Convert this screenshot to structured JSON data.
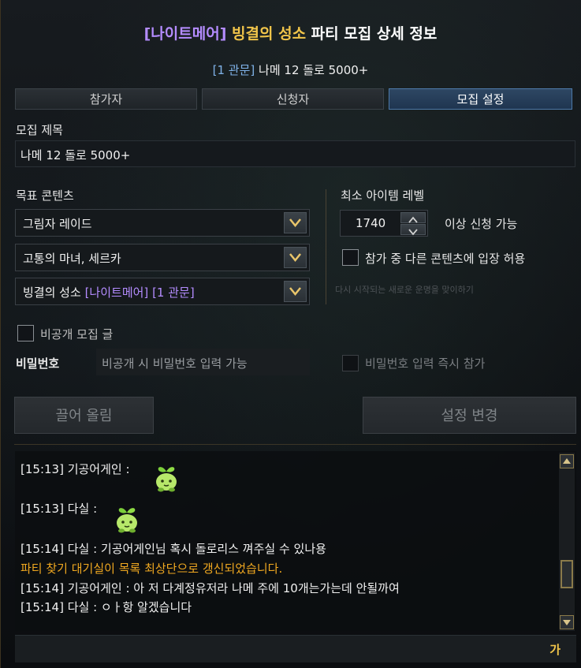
{
  "title": {
    "difficulty": "[나이트메어]",
    "raid": "빙결의 성소",
    "rest": "파티 모집 상세 정보"
  },
  "subtitle": {
    "gate": "[1 관문]",
    "text": "나메 12 돌로 5000+"
  },
  "tabs": [
    {
      "label": "참가자",
      "active": false
    },
    {
      "label": "신청자",
      "active": false
    },
    {
      "label": "모집 설정",
      "active": true
    }
  ],
  "recruit_title": {
    "label": "모집 제목",
    "value": "나메 12 돌로 5000+"
  },
  "target_content": {
    "label": "목표 콘텐츠",
    "selects": [
      {
        "value": "그림자 레이드"
      },
      {
        "value": "고통의 마녀, 세르카"
      },
      {
        "value_main": "빙결의 성소",
        "value_diff": "[나이트메어]",
        "value_gate": "[1 관문]"
      }
    ]
  },
  "min_item_level": {
    "label": "최소 아이템 레벨",
    "value": "1740",
    "suffix": "이상 신청 가능"
  },
  "allow_other_content": {
    "label": "참가 중 다른 콘텐츠에 입장 허용",
    "checked": false
  },
  "faint_hint": "다시 시작되는 새로운 운명을 맞이하기",
  "private_post": {
    "label": "비공개 모집 글",
    "checked": false
  },
  "password": {
    "label": "비밀번호",
    "placeholder": "비공개 시 비밀번호 입력 가능"
  },
  "password_instant_join": {
    "label": "비밀번호 입력 즉시 참가",
    "checked": false
  },
  "buttons": {
    "bump": "끌어 올림",
    "apply_settings": "설정 변경"
  },
  "chat": {
    "lines": [
      {
        "text": "[15:13] 기공어게인 :",
        "type": "normal",
        "emoji": true
      },
      {
        "text": "[15:13] 다실 :",
        "type": "normal",
        "emoji": true
      },
      {
        "text": "[15:14] 다실 : 기공어게인님 혹시 돌로리스 껴주실 수 있나용",
        "type": "normal"
      },
      {
        "text": "파티 찾기 대기실이 목록 최상단으로 갱신되었습니다.",
        "type": "system"
      },
      {
        "text": "[15:14] 기공어게인 : 아 저 다계정유저라 나메 주에 10개는가는데 안될까여",
        "type": "normal"
      },
      {
        "text": "[15:14] 다실 : ㅇㅏ항 알겠습니다",
        "type": "normal"
      }
    ],
    "input_lang": "가"
  },
  "colors": {
    "accent_purple": "#b48cff",
    "accent_gold": "#f0c44a",
    "system_text": "#f0a820",
    "tab_active": "#2e4763"
  }
}
